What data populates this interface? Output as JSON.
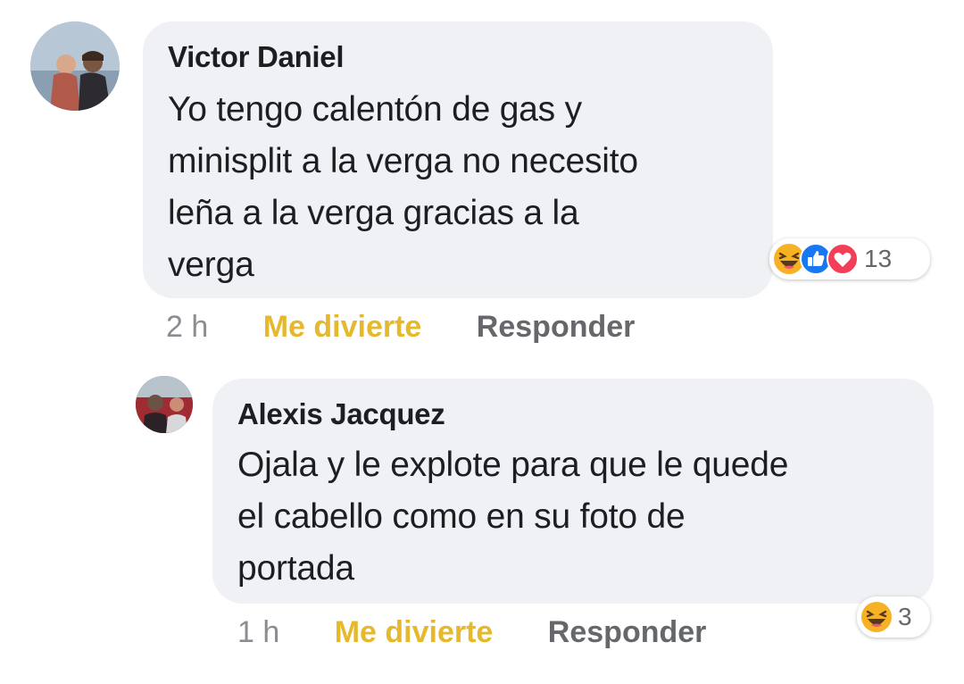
{
  "comments": [
    {
      "author": "Victor Daniel",
      "text_lines": [
        "Yo tengo calentón de gas y",
        "minisplit a la verga no necesito",
        "leña a la verga gracias a la",
        "verga"
      ],
      "time": "2 h",
      "react_label": "Me divierte",
      "reply_label": "Responder",
      "reaction_icons": [
        "haha-icon",
        "like-icon",
        "love-icon"
      ],
      "reaction_count": "13"
    },
    {
      "author": "Alexis Jacquez",
      "text_lines": [
        "Ojala y le explote para que le quede",
        "el cabello como en su foto de",
        "portada"
      ],
      "time": "1 h",
      "react_label": "Me divierte",
      "reply_label": "Responder",
      "reaction_icons": [
        "haha-icon"
      ],
      "reaction_count": "3"
    }
  ],
  "colors": {
    "bubble": "#f0f1f4",
    "react_active": "#e6b82c",
    "meta_gray": "#8a8d91",
    "like_blue": "#1877f2",
    "love_red": "#f33e58",
    "haha_yellow": "#f7b125"
  }
}
